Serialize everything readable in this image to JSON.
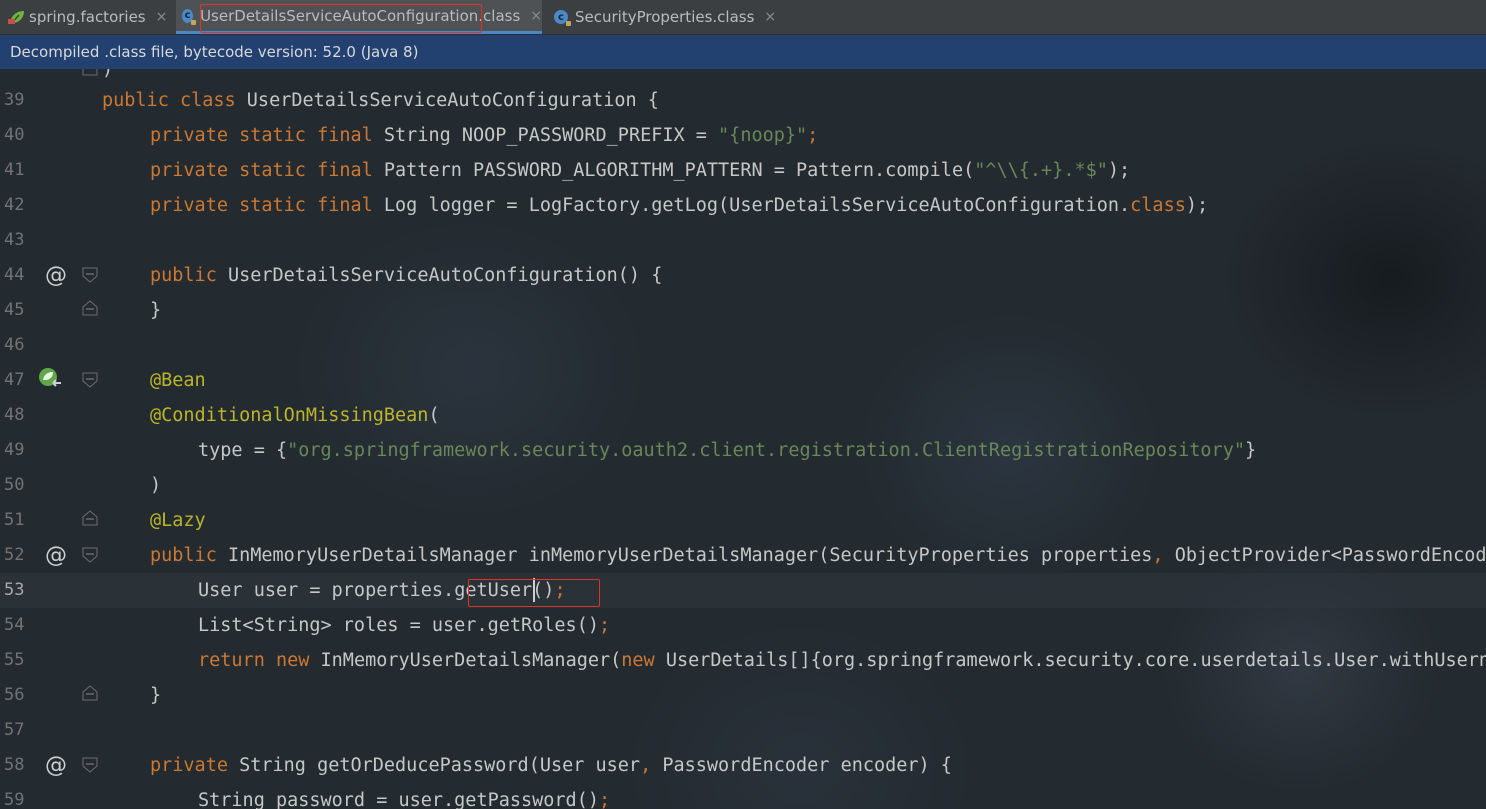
{
  "tabs": [
    {
      "label": "spring.factories",
      "icon": "spring-leaf-icon",
      "active": false
    },
    {
      "label": "UserDetailsServiceAutoConfiguration.class",
      "icon": "class-icon",
      "active": true
    },
    {
      "label": "SecurityProperties.class",
      "icon": "class-icon",
      "active": false
    }
  ],
  "close_glyph": "×",
  "info_bar": {
    "text": "Decompiled .class file, bytecode version: 52.0 (Java 8)"
  },
  "editor": {
    "lines": [
      {
        "num": "39"
      },
      {
        "num": "40"
      },
      {
        "num": "41"
      },
      {
        "num": "42"
      },
      {
        "num": "43"
      },
      {
        "num": "44"
      },
      {
        "num": "45"
      },
      {
        "num": "46"
      },
      {
        "num": "47"
      },
      {
        "num": "48"
      },
      {
        "num": "49"
      },
      {
        "num": "50"
      },
      {
        "num": "51"
      },
      {
        "num": "52"
      },
      {
        "num": "53"
      },
      {
        "num": "54"
      },
      {
        "num": "55"
      },
      {
        "num": "56"
      },
      {
        "num": "57"
      },
      {
        "num": "58"
      },
      {
        "num": "59"
      }
    ],
    "code": {
      "l38": ")",
      "l39a": "public class ",
      "l39b": "UserDetailsServiceAutoConfiguration {",
      "l40a": "private static final ",
      "l40b": "String NOOP_PASSWORD_PREFIX = ",
      "l40c": "\"{noop}\"",
      "l40d": ";",
      "l41a": "private static final ",
      "l41b": "Pattern PASSWORD_ALGORITHM_PATTERN = Pattern.compile(",
      "l41c": "\"^\\\\{.+}.*$\"",
      "l41d": ");",
      "l42a": "private static final ",
      "l42b": "Log logger = LogFactory.getLog(UserDetailsServiceAutoConfiguration.",
      "l42c": "class",
      "l42d": ");",
      "l44a": "public ",
      "l44b": "UserDetailsServiceAutoConfiguration() {",
      "l45": "}",
      "l47": "@Bean",
      "l48a": "@ConditionalOnMissingBean",
      "l48b": "(",
      "l49a": "type = {",
      "l49b": "\"org.springframework.security.oauth2.client.registration.ClientRegistrationRepository\"",
      "l49c": "}",
      "l50": ")",
      "l51": "@Lazy",
      "l52a": "public ",
      "l52b": "InMemoryUserDetailsManager inMemoryUserDetailsManager(SecurityProperties properties",
      "l52c": ", ",
      "l52d": "ObjectProvider<PasswordEncoder> passwordEncoder) {",
      "l53a": "User user = properties.",
      "l53b": "getUser",
      "l53c": "()",
      "l53d": ";",
      "l54a": "List<String> roles = user.getRoles()",
      "l54b": ";",
      "l55a": "return new ",
      "l55b": "InMemoryUserDetailsManager(",
      "l55c": "new ",
      "l55d": "UserDetails[]{org.springframework.security.core.userdetails.User.withUsername(user.getName())",
      "l56": "}",
      "l58a": "private ",
      "l58b": "String getOrDeducePassword(User user",
      "l58c": ", ",
      "l58d": "PasswordEncoder encoder) {",
      "l59a": "String password = user.getPassword()",
      "l59b": ";"
    },
    "gutter_markers": {
      "override": "@",
      "bean": "bean-navigate-icon"
    }
  },
  "colors": {
    "keyword": "#cc7832",
    "string": "#6a8759",
    "annotation": "#bbb529",
    "highlight_box": "#e0322c",
    "info_bar": "#224070"
  }
}
